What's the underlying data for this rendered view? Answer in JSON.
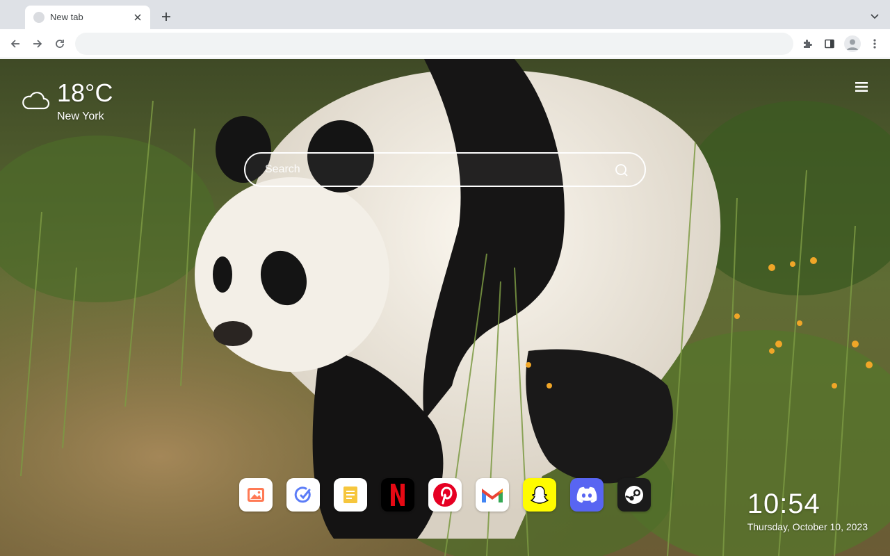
{
  "browser": {
    "tab": {
      "title": "New tab"
    },
    "omnibox": {
      "value": "",
      "placeholder": ""
    },
    "icons": [
      "close-icon",
      "plus-icon",
      "chevron-down-icon",
      "back-arrow-icon",
      "forward-arrow-icon",
      "reload-icon",
      "extensions-icon",
      "side-panel-icon",
      "profile-icon",
      "more-vert-icon"
    ]
  },
  "weather": {
    "temperature": "18°C",
    "city": "New York",
    "icon": "cloud-icon"
  },
  "search": {
    "placeholder": "Search",
    "icon": "search-icon"
  },
  "shortcuts": [
    {
      "name": "Photos",
      "icon": "image-icon",
      "bg": "#ffffff"
    },
    {
      "name": "Tasks",
      "icon": "check-circle-icon",
      "bg": "#ffffff"
    },
    {
      "name": "Notes",
      "icon": "note-icon",
      "bg": "#ffffff"
    },
    {
      "name": "Netflix",
      "icon": "netflix-icon",
      "bg": "#000000"
    },
    {
      "name": "Pinterest",
      "icon": "pinterest-icon",
      "bg": "#ffffff"
    },
    {
      "name": "Gmail",
      "icon": "gmail-icon",
      "bg": "#ffffff"
    },
    {
      "name": "Snapchat",
      "icon": "snapchat-icon",
      "bg": "#fffc00"
    },
    {
      "name": "Discord",
      "icon": "discord-icon",
      "bg": "#5865f2"
    },
    {
      "name": "Steam",
      "icon": "steam-icon",
      "bg": "#1b1b1b"
    }
  ],
  "clock": {
    "time": "10:54",
    "date": "Thursday, October 10, 2023"
  },
  "colors": {
    "tabstrip": "#dee1e6",
    "netflix_red": "#e50914",
    "pinterest_red": "#e60023",
    "snapchat_yellow": "#fffc00",
    "discord_blurple": "#5865f2"
  }
}
